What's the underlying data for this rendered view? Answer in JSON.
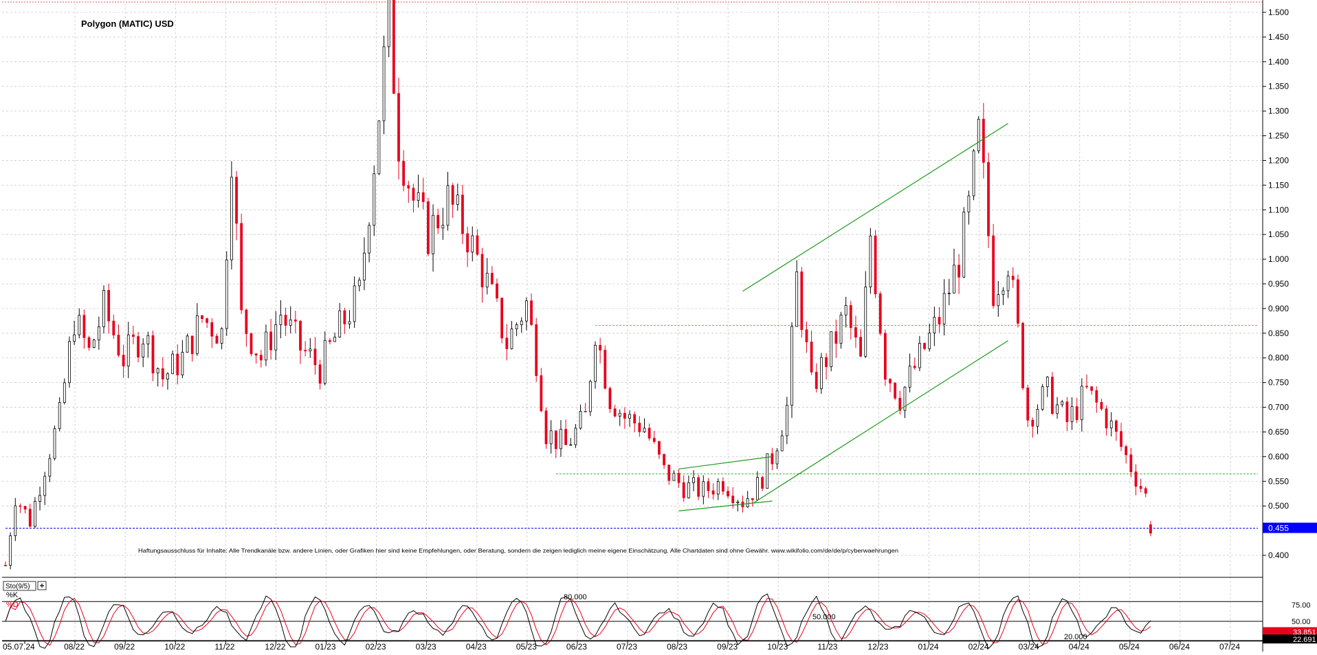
{
  "chart_data": [
    {
      "type": "candlestick",
      "title": "Polygon (MATIC) USD",
      "disclaimer": "Haftungsausschluss für Inhalte: Alle Trendkanäle bzw. andere Linien, oder Grafiken hier sind keine Empfehlungen, oder Beratung, sondern die zeigen lediglich meine eigene Einschätzung. Alle Chartdaten sind ohne Gewähr.  www.wikifolio.com/de/de/p/cyberwaehrungen",
      "y_ticks": [
        "1.500",
        "1.450",
        "1.400",
        "1.350",
        "1.300",
        "1.250",
        "1.200",
        "1.150",
        "1.100",
        "1.050",
        "1.000",
        "0.950",
        "0.900",
        "0.850",
        "0.800",
        "0.750",
        "0.700",
        "0.650",
        "0.600",
        "0.550",
        "0.500",
        "0.400"
      ],
      "ylim": [
        0.375,
        1.525
      ],
      "x_ticks": [
        "05.07.24",
        "08/22",
        "09/22",
        "10/22",
        "11/22",
        "12/22",
        "01/23",
        "02/23",
        "03/23",
        "04/23",
        "05/23",
        "06/23",
        "07/23",
        "08/23",
        "09/23",
        "10/23",
        "11/23",
        "12/23",
        "01/24",
        "02/24",
        "03/24",
        "04/24",
        "05/24",
        "06/24",
        "07/24"
      ],
      "grid": true,
      "last_price": "0.455",
      "colors": {
        "up": "#000000",
        "down": "#e8001c",
        "trend": "#1a9a1a",
        "price_line": "#0000ff",
        "price_label_bg": "#0000ff",
        "support": "#2ebd2e",
        "resistance": "#e07070"
      },
      "price_path": [
        [
          0,
          0.38
        ],
        [
          2,
          0.52
        ],
        [
          5,
          0.47
        ],
        [
          8,
          0.58
        ],
        [
          11,
          0.68
        ],
        [
          14,
          0.88
        ],
        [
          17,
          0.81
        ],
        [
          20,
          0.9
        ],
        [
          24,
          0.8
        ],
        [
          28,
          0.85
        ],
        [
          32,
          0.76
        ],
        [
          36,
          0.8
        ],
        [
          40,
          0.88
        ],
        [
          44,
          0.85
        ],
        [
          46,
          1.22
        ],
        [
          48,
          0.88
        ],
        [
          52,
          0.8
        ],
        [
          56,
          0.89
        ],
        [
          60,
          0.82
        ],
        [
          64,
          0.78
        ],
        [
          68,
          0.86
        ],
        [
          72,
          0.93
        ],
        [
          75,
          1.2
        ],
        [
          78,
          1.5
        ],
        [
          80,
          1.24
        ],
        [
          83,
          1.12
        ],
        [
          86,
          1.05
        ],
        [
          90,
          1.12
        ],
        [
          94,
          1.05
        ],
        [
          98,
          0.95
        ],
        [
          102,
          0.83
        ],
        [
          106,
          0.91
        ],
        [
          108,
          0.8
        ],
        [
          110,
          0.65
        ],
        [
          114,
          0.62
        ],
        [
          118,
          0.68
        ],
        [
          120,
          0.86
        ],
        [
          123,
          0.72
        ],
        [
          126,
          0.68
        ],
        [
          130,
          0.66
        ],
        [
          134,
          0.57
        ],
        [
          138,
          0.54
        ],
        [
          142,
          0.53
        ],
        [
          146,
          0.55
        ],
        [
          150,
          0.51
        ],
        [
          153,
          0.54
        ],
        [
          156,
          0.6
        ],
        [
          159,
          0.7
        ],
        [
          161,
          0.96
        ],
        [
          164,
          0.74
        ],
        [
          168,
          0.82
        ],
        [
          171,
          0.89
        ],
        [
          174,
          0.79
        ],
        [
          176,
          1.05
        ],
        [
          179,
          0.78
        ],
        [
          182,
          0.72
        ],
        [
          186,
          0.8
        ],
        [
          190,
          0.88
        ],
        [
          194,
          1.0
        ],
        [
          196,
          1.1
        ],
        [
          198,
          1.25
        ],
        [
          199,
          1.16
        ],
        [
          201,
          0.94
        ],
        [
          204,
          1.0
        ],
        [
          206,
          0.85
        ],
        [
          208,
          0.68
        ],
        [
          212,
          0.73
        ],
        [
          216,
          0.67
        ],
        [
          220,
          0.73
        ],
        [
          224,
          0.68
        ],
        [
          228,
          0.6
        ],
        [
          230,
          0.56
        ],
        [
          232,
          0.52
        ],
        [
          233,
          0.44
        ]
      ],
      "annotations": [
        {
          "type": "trendline",
          "from": [
            150,
            0.935
          ],
          "to": [
            204,
            1.275
          ]
        },
        {
          "type": "trendline",
          "from": [
            152,
            0.505
          ],
          "to": [
            204,
            0.835
          ]
        },
        {
          "type": "trendline",
          "from": [
            137,
            0.575
          ],
          "to": [
            156,
            0.6
          ]
        },
        {
          "type": "trendline",
          "from": [
            137,
            0.49
          ],
          "to": [
            156,
            0.51
          ]
        },
        {
          "type": "hline",
          "y": 0.565,
          "from": 112,
          "to": 248,
          "color": "support"
        },
        {
          "type": "hline",
          "y": 0.866,
          "from": 120,
          "to": 248,
          "color": "resistance"
        },
        {
          "type": "hline",
          "y": 0.455,
          "from": 0,
          "to": 248,
          "color": "price_line"
        }
      ]
    },
    {
      "type": "line",
      "indicator_label": "Sto(9/5)",
      "series": [
        {
          "name": "%K",
          "color": "#000000"
        },
        {
          "name": "%D",
          "color": "#e8001c"
        }
      ],
      "level_labels": [
        "80.000",
        "50.000",
        "20.000"
      ],
      "y_ticks": [
        "75.00",
        "50.00"
      ],
      "ylim": [
        0,
        100
      ],
      "last_k": "33.851",
      "last_d": "22.691"
    }
  ]
}
